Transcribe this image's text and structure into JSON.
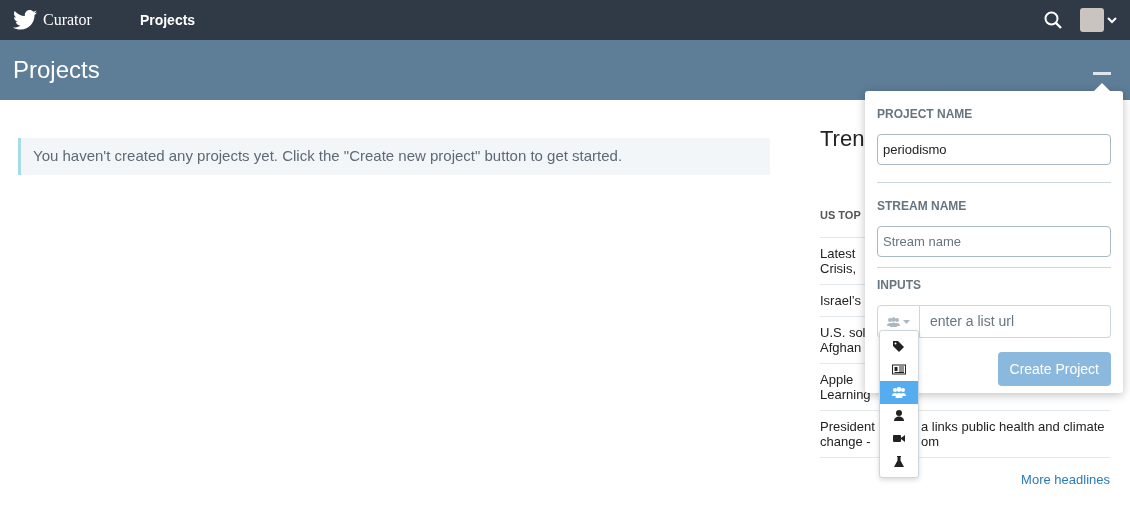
{
  "navbar": {
    "brand": "Curator",
    "links": [
      {
        "label": "Projects",
        "selected": true
      }
    ]
  },
  "page_header": {
    "title": "Projects"
  },
  "notice": "You haven't created any projects yet. Click the \"Create new project\" button to get started.",
  "trending": {
    "title": "Tren",
    "section": "US TOP",
    "rows": [
      {
        "lines": [
          [
            "Latest"
          ],
          [
            "Crisis,"
          ]
        ]
      },
      {
        "lines": [
          [
            "Israel’s"
          ]
        ]
      },
      {
        "lines": [
          [
            "U.S. sol"
          ],
          [
            "Afghan"
          ]
        ]
      },
      {
        "lines": [
          [
            "Apple"
          ],
          [
            "Learning"
          ]
        ]
      },
      {
        "lines": [
          [
            "President",
            "a links public health and climate"
          ],
          [
            "change -",
            "om"
          ]
        ]
      }
    ],
    "more_link": "More headlines"
  },
  "popover": {
    "project_name": {
      "label": "PROJECT NAME",
      "value": "periodismo"
    },
    "stream_name": {
      "label": "STREAM NAME",
      "placeholder": "Stream name"
    },
    "inputs": {
      "label": "INPUTS",
      "placeholder": "enter a list url",
      "source_menu": [
        {
          "kind": "tag",
          "selected": false
        },
        {
          "kind": "newspaper",
          "selected": false
        },
        {
          "kind": "users",
          "selected": true
        },
        {
          "kind": "user",
          "selected": false
        },
        {
          "kind": "video",
          "selected": false
        },
        {
          "kind": "flask",
          "selected": false
        }
      ]
    },
    "submit": {
      "label": "Create Project",
      "disabled": true
    }
  }
}
